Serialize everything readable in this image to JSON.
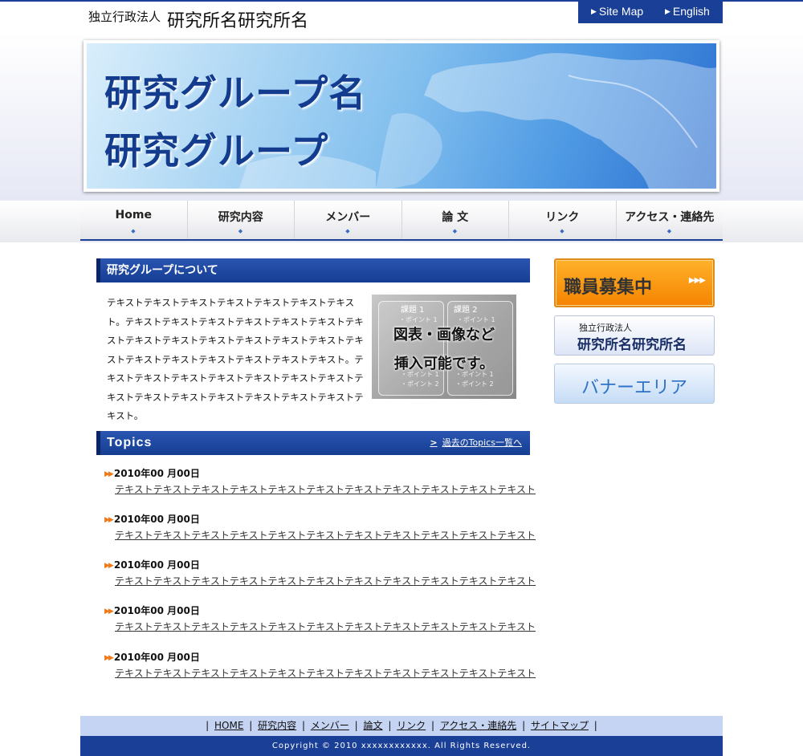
{
  "header": {
    "org_type": "独立行政法人",
    "institute_name": "研究所名研究所名",
    "utility_links": [
      {
        "label": "Site Map"
      },
      {
        "label": "English"
      }
    ]
  },
  "banner": {
    "line1": "研究グループ名",
    "line2": "研究グループ"
  },
  "nav": {
    "items": [
      {
        "label": "Home"
      },
      {
        "label": "研究内容"
      },
      {
        "label": "メンバー"
      },
      {
        "label": "論 文"
      },
      {
        "label": "リンク"
      },
      {
        "label": "アクセス・連絡先"
      }
    ]
  },
  "about": {
    "heading": "研究グループについて",
    "body": "テキストテキストテキストテキストテキストテキストテキスト。テキストテキストテキストテキストテキストテキストテキストテキストテキストテキストテキストテキストテキストテキストテキストテキストテキストテキストテキストテキスト。テキストテキストテキストテキストテキストテキストテキストテキストテキストテキストテキストテキストテキストテキストテキスト。",
    "figure": {
      "task1": "課題 1",
      "task2": "課題 2",
      "line1": "図表・画像など",
      "line2": "挿入可能です。",
      "point1": "・ポイント 1",
      "point2": "・ポイント 2"
    }
  },
  "topics": {
    "heading": "Topics",
    "past_link": "過去のTopics一覧へ",
    "items": [
      {
        "date": "2010年00 月00日",
        "text": "テキストテキストテキストテキストテキストテキストテキストテキストテキストテキストテキスト"
      },
      {
        "date": "2010年00 月00日",
        "text": "テキストテキストテキストテキストテキストテキストテキストテキストテキストテキストテキスト"
      },
      {
        "date": "2010年00 月00日",
        "text": "テキストテキストテキストテキストテキストテキストテキストテキストテキストテキストテキスト"
      },
      {
        "date": "2010年00 月00日",
        "text": "テキストテキストテキストテキストテキストテキストテキストテキストテキストテキストテキスト"
      },
      {
        "date": "2010年00 月00日",
        "text": "テキストテキストテキストテキストテキストテキストテキストテキストテキストテキストテキスト"
      }
    ]
  },
  "sidebar": {
    "recruit": "職員募集中",
    "institute_banner": {
      "small": "独立行政法人",
      "name": "研究所名研究所名"
    },
    "banner_area": "バナーエリア"
  },
  "footer": {
    "links": [
      {
        "label": "HOME"
      },
      {
        "label": "研究内容"
      },
      {
        "label": "メンバー"
      },
      {
        "label": "論文"
      },
      {
        "label": "リンク"
      },
      {
        "label": "アクセス・連絡先"
      },
      {
        "label": "サイトマップ"
      }
    ],
    "copyright": "Copyright © 2010 xxxxxxxxxxxx. All Rights Reserved."
  },
  "colors": {
    "primary": "#1a3f96",
    "accent": "#f58400",
    "footer_nav_bg": "#c5d4f2"
  }
}
